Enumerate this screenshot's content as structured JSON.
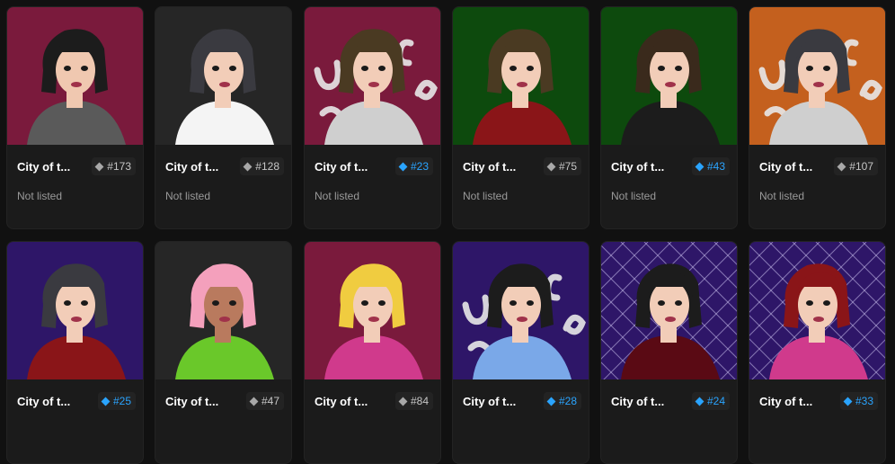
{
  "listing_text": "Not listed",
  "cards": [
    {
      "name": "City of t...",
      "number": "#173",
      "rare": false,
      "bg": "#7a1a3c",
      "hair": "#1c1c1c",
      "top": "#5a5a5a",
      "skin": "#f0c8b0",
      "deco": "none",
      "listing": "Not listed"
    },
    {
      "name": "City of t...",
      "number": "#128",
      "rare": false,
      "bg": "#262626",
      "hair": "#3a3a40",
      "top": "#f4f4f4",
      "skin": "#f2cdb8",
      "deco": "none",
      "listing": "Not listed"
    },
    {
      "name": "City of t...",
      "number": "#23",
      "rare": true,
      "bg": "#7a1a3c",
      "hair": "#4a3a22",
      "top": "#cfcfcf",
      "skin": "#f2cdb8",
      "deco": "graffiti",
      "listing": "Not listed"
    },
    {
      "name": "City of t...",
      "number": "#75",
      "rare": false,
      "bg": "#0d4a0d",
      "hair": "#4a3a22",
      "top": "#8a1518",
      "skin": "#f2cdb8",
      "deco": "none",
      "listing": "Not listed"
    },
    {
      "name": "City of t...",
      "number": "#43",
      "rare": true,
      "bg": "#0d4a0d",
      "hair": "#3a2a1c",
      "top": "#1c1c1c",
      "skin": "#f2cdb8",
      "deco": "none",
      "listing": "Not listed"
    },
    {
      "name": "City of t...",
      "number": "#107",
      "rare": false,
      "bg": "#c4601e",
      "hair": "#3a3a40",
      "top": "#cfcfcf",
      "skin": "#f2cdb8",
      "deco": "graffiti",
      "listing": "Not listed"
    },
    {
      "name": "City of t...",
      "number": "#25",
      "rare": true,
      "bg": "#2e1668",
      "hair": "#3a3a40",
      "top": "#8a1518",
      "skin": "#f2cdb8",
      "deco": "none"
    },
    {
      "name": "City of t...",
      "number": "#47",
      "rare": false,
      "bg": "#262626",
      "hair": "#f4a0bc",
      "top": "#6ac82a",
      "skin": "#b97a5e",
      "deco": "none"
    },
    {
      "name": "City of t...",
      "number": "#84",
      "rare": false,
      "bg": "#7a1a3c",
      "hair": "#f0cc40",
      "top": "#d03a8c",
      "skin": "#f2cdb8",
      "deco": "none"
    },
    {
      "name": "City of t...",
      "number": "#28",
      "rare": true,
      "bg": "#2e1668",
      "hair": "#1c1c1c",
      "top": "#7aa8e8",
      "skin": "#f2cdb8",
      "deco": "graffiti"
    },
    {
      "name": "City of t...",
      "number": "#24",
      "rare": true,
      "bg": "#2e1668",
      "hair": "#1c1c1c",
      "top": "#5a0a14",
      "skin": "#f2cdb8",
      "deco": "lattice"
    },
    {
      "name": "City of t...",
      "number": "#33",
      "rare": true,
      "bg": "#2e1668",
      "hair": "#8a1518",
      "top": "#d03a8c",
      "skin": "#f2cdb8",
      "deco": "lattice"
    }
  ]
}
